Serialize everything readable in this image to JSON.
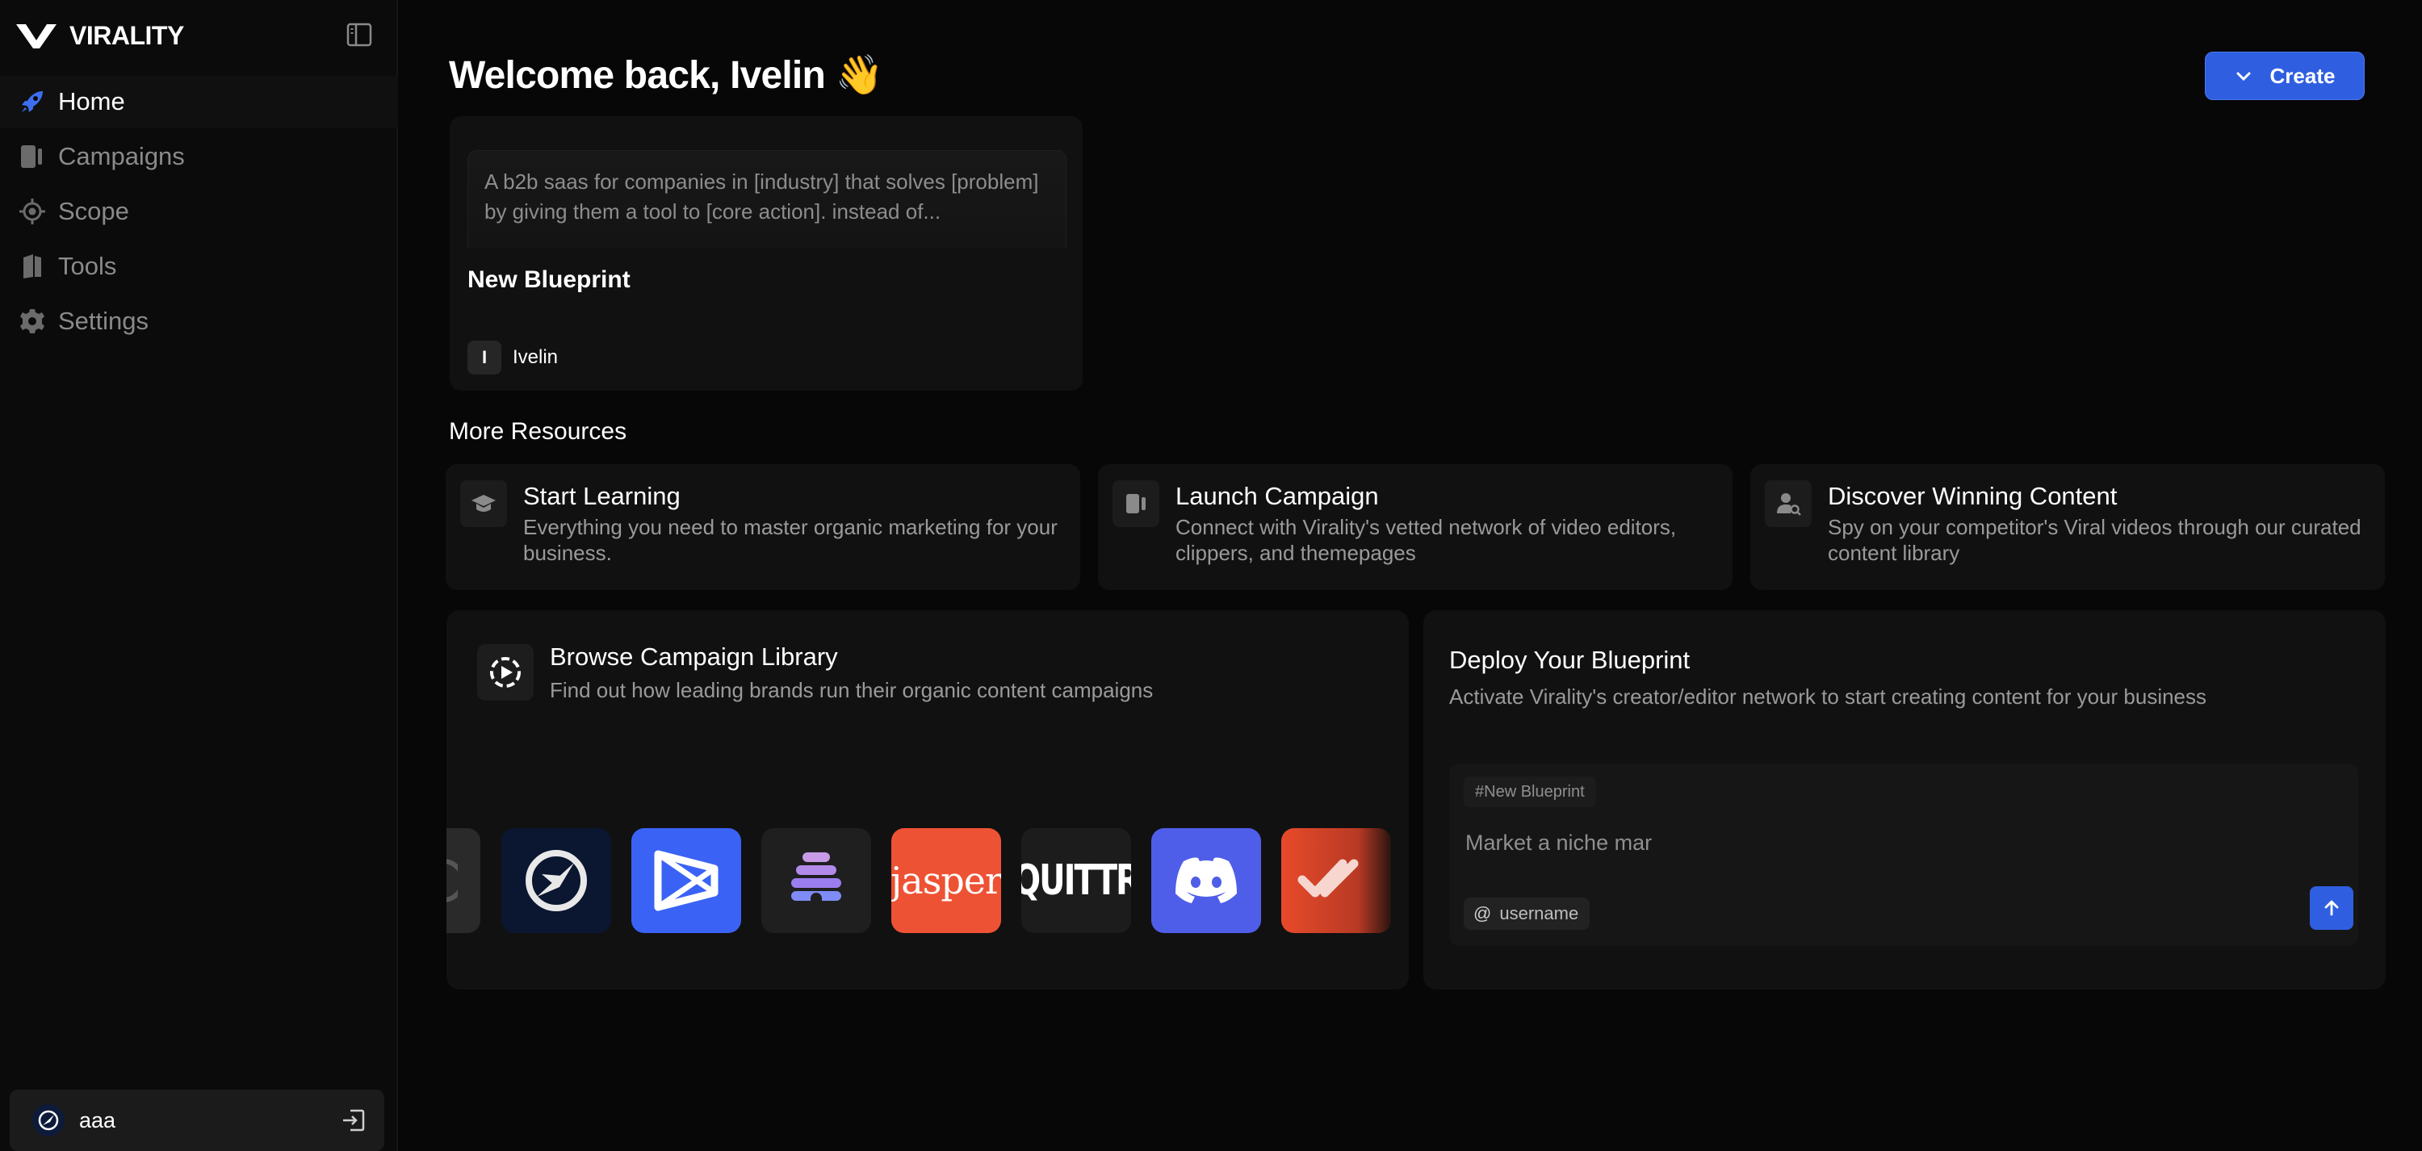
{
  "brand": {
    "name": "VIRALITY"
  },
  "sidebar": {
    "items": [
      {
        "label": "Home",
        "icon": "rocket-icon",
        "active": true
      },
      {
        "label": "Campaigns",
        "icon": "campaign-icon"
      },
      {
        "label": "Scope",
        "icon": "scope-icon"
      },
      {
        "label": "Tools",
        "icon": "tools-icon"
      },
      {
        "label": "Settings",
        "icon": "gear-icon"
      }
    ],
    "account": {
      "name": "aaa"
    }
  },
  "header": {
    "title": "Welcome back, Ivelin 👋",
    "create_label": "Create"
  },
  "blueprint_card": {
    "preview": "A b2b saas for companies in [industry] that solves [problem] by giving them a tool to [core action]. instead of...",
    "title": "New Blueprint",
    "owner_initial": "I",
    "owner_name": "Ivelin"
  },
  "resources": {
    "title": "More Resources",
    "items": [
      {
        "title": "Start Learning",
        "desc": "Everything you need to master organic marketing for your business.",
        "icon": "graduation-cap-icon"
      },
      {
        "title": "Launch Campaign",
        "desc": "Connect with Virality's vetted network of video editors, clippers, and themepages",
        "icon": "campaign-icon"
      },
      {
        "title": "Discover Winning Content",
        "desc": "Spy on your competitor's Viral videos through our curated content library",
        "icon": "user-search-icon"
      }
    ]
  },
  "library": {
    "title": "Browse Campaign Library",
    "desc": "Find out how leading brands run their organic content campaigns",
    "brands": [
      "jasper",
      "QUITTR"
    ]
  },
  "deploy": {
    "title": "Deploy Your Blueprint",
    "desc": "Activate Virality's creator/editor network to start creating content for your business",
    "tag": "#New Blueprint",
    "prompt": "Market a niche mar",
    "mention": "username"
  },
  "colors": {
    "accent": "#2f5fe0",
    "background": "#070707",
    "card": "#111111"
  }
}
